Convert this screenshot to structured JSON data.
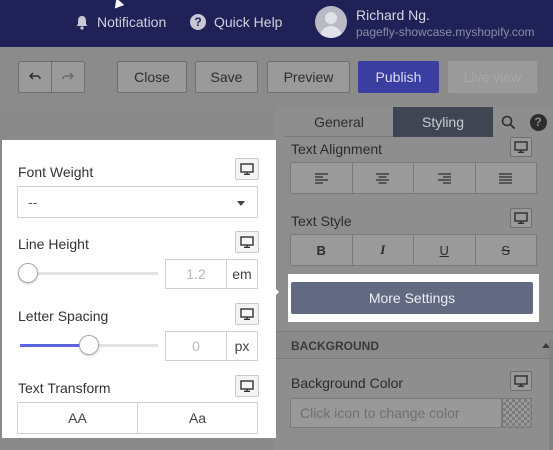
{
  "topbar": {
    "notification_label": "Notification",
    "help_label": "Quick Help",
    "user_name": "Richard Ng.",
    "user_shop": "pagefly-showcase.myshopify.com"
  },
  "toolbar": {
    "close_label": "Close",
    "save_label": "Save",
    "preview_label": "Preview",
    "publish_label": "Publish",
    "liveview_label": "Live view"
  },
  "tabs": {
    "general": "General",
    "styling": "Styling"
  },
  "right_panel": {
    "text_alignment_label": "Text Alignment",
    "text_style_label": "Text Style",
    "style_buttons": [
      "B",
      "I",
      "U",
      "S"
    ],
    "more_settings_label": "More Settings",
    "background_section": "BACKGROUND",
    "background_color_label": "Background Color",
    "color_placeholder": "Click icon to change color"
  },
  "card": {
    "font_weight_label": "Font Weight",
    "font_weight_value": "--",
    "line_height_label": "Line Height",
    "line_height_value": "1.2",
    "line_height_unit": "em",
    "line_height_slider": 0,
    "letter_spacing_label": "Letter Spacing",
    "letter_spacing_value": "0",
    "letter_spacing_unit": "px",
    "letter_spacing_slider": 0.5,
    "text_transform_label": "Text Transform",
    "transform_options": [
      "AA",
      "Aa"
    ]
  },
  "colors": {
    "topbar": "#1f2157",
    "publish": "#3a3ea0",
    "more_settings": "#616a80",
    "slider_fill": "#5e63e0"
  }
}
